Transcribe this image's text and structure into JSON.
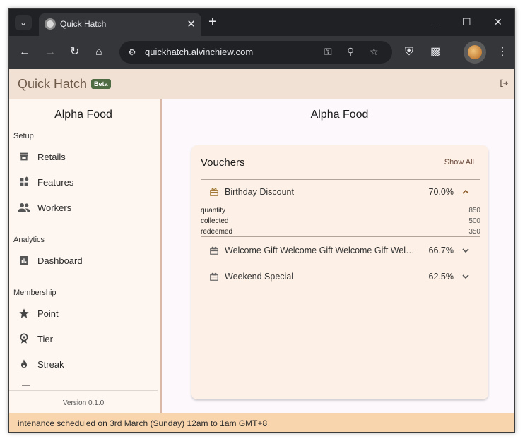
{
  "browser": {
    "tab_title": "Quick Hatch",
    "url": "quickhatch.alvinchiew.com"
  },
  "app": {
    "title": "Quick Hatch",
    "badge": "Beta"
  },
  "sidebar": {
    "org_name": "Alpha Food",
    "sections": {
      "setup": "Setup",
      "analytics": "Analytics",
      "membership": "Membership"
    },
    "items": {
      "retails": "Retails",
      "features": "Features",
      "workers": "Workers",
      "dashboard": "Dashboard",
      "point": "Point",
      "tier": "Tier",
      "streak": "Streak"
    },
    "version": "Version 0.1.0"
  },
  "main": {
    "title": "Alpha Food",
    "vouchers_card": {
      "title": "Vouchers",
      "show_all": "Show All",
      "vouchers": [
        {
          "name": "Birthday Discount",
          "percent": "70.0%",
          "expanded": true,
          "stats": [
            {
              "label": "quantity",
              "value": "850"
            },
            {
              "label": "collected",
              "value": "500"
            },
            {
              "label": "redeemed",
              "value": "350"
            }
          ]
        },
        {
          "name": "Welcome Gift Welcome Gift Welcome Gift Welcome Gift",
          "percent": "66.7%",
          "expanded": false
        },
        {
          "name": "Weekend Special",
          "percent": "62.5%",
          "expanded": false
        }
      ]
    }
  },
  "banner": {
    "text": "intenance scheduled on 3rd March (Sunday) 12am to 1am GMT+8"
  },
  "colors": {
    "appbar": "#f1e1d5",
    "card": "#fdf0e6",
    "banner": "#f9d5ae",
    "beta_badge": "#4e6b44"
  }
}
